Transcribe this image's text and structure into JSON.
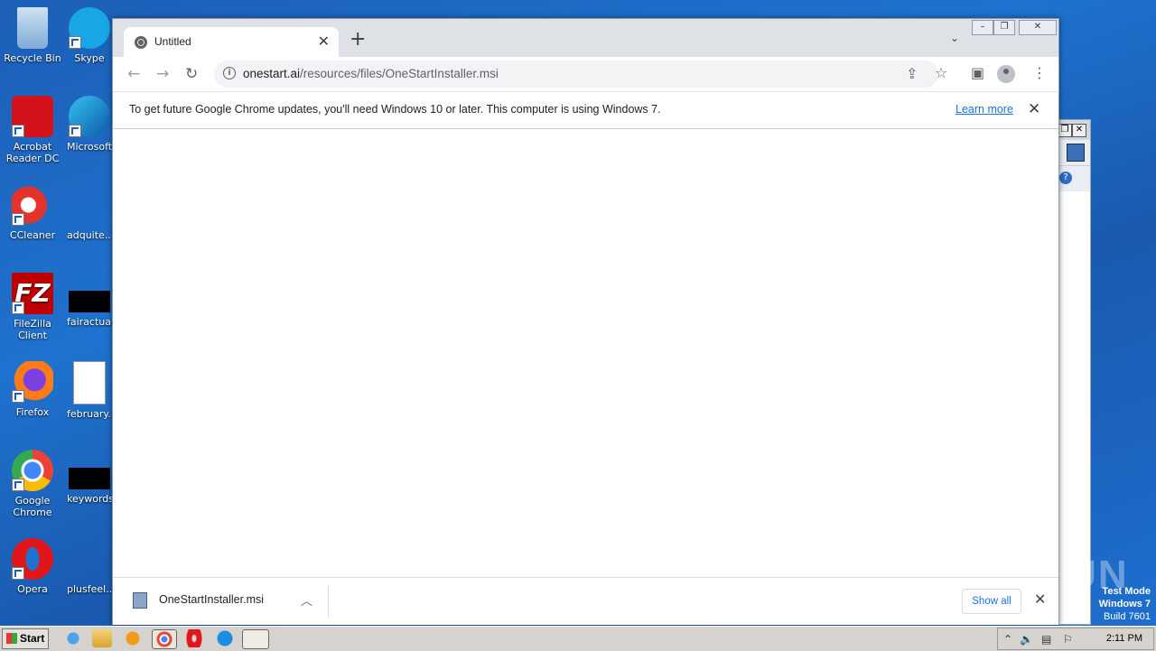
{
  "desktop": {
    "icons": [
      {
        "label": "Recycle Bin"
      },
      {
        "label": "Skype"
      },
      {
        "label": "Acrobat Reader DC"
      },
      {
        "label": "Microsoft"
      },
      {
        "label": "CCleaner"
      },
      {
        "label": "adquite..."
      },
      {
        "label": "FileZilla Client"
      },
      {
        "label": "fairactua..."
      },
      {
        "label": "Firefox"
      },
      {
        "label": "february..."
      },
      {
        "label": "Google Chrome"
      },
      {
        "label": "keywords..."
      },
      {
        "label": "Opera"
      },
      {
        "label": "plusfeel..."
      }
    ],
    "watermark": "ANY RUN",
    "test_mode": {
      "line1": "Test Mode",
      "line2": "Windows 7",
      "line3": "Build 7601"
    }
  },
  "chrome": {
    "tab": {
      "title": "Untitled",
      "icon": "globe-icon"
    },
    "new_tab_symbol": "+",
    "url_host": "onestart.ai",
    "url_path": "/resources/files/OneStartInstaller.msi",
    "infobar": {
      "message": "To get future Google Chrome updates, you'll need Windows 10 or later. This computer is using Windows 7.",
      "link": "Learn more"
    },
    "download": {
      "filename": "OneStartInstaller.msi",
      "show_all": "Show all"
    }
  },
  "taskbar": {
    "start_label": "Start",
    "clock": "2:11 PM"
  },
  "colors": {
    "desktop_blue": "#1f72cf",
    "link_blue": "#1a73e8",
    "tabstrip": "#dee1e6"
  }
}
